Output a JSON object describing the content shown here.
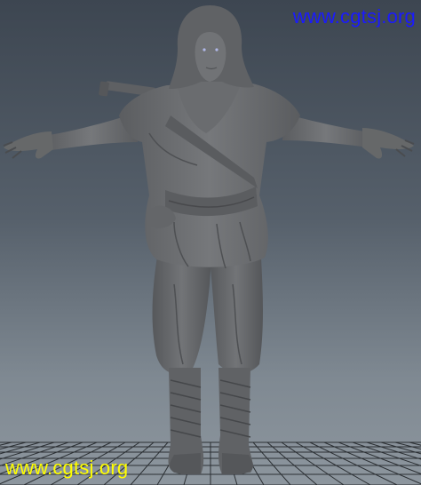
{
  "watermarks": {
    "top": {
      "text": "www.cgtsj.org",
      "color": "#1a1aff"
    },
    "bottom": {
      "text": "www.cgtsj.org",
      "color": "#ffff00"
    }
  },
  "viewport": {
    "background_top": "#3d4651",
    "background_bottom": "#8d969e",
    "grid_color": "#2b2f33",
    "model_color": "#6d6f72"
  },
  "model": {
    "name": "character-t-pose",
    "shading": "gray-untextured"
  }
}
